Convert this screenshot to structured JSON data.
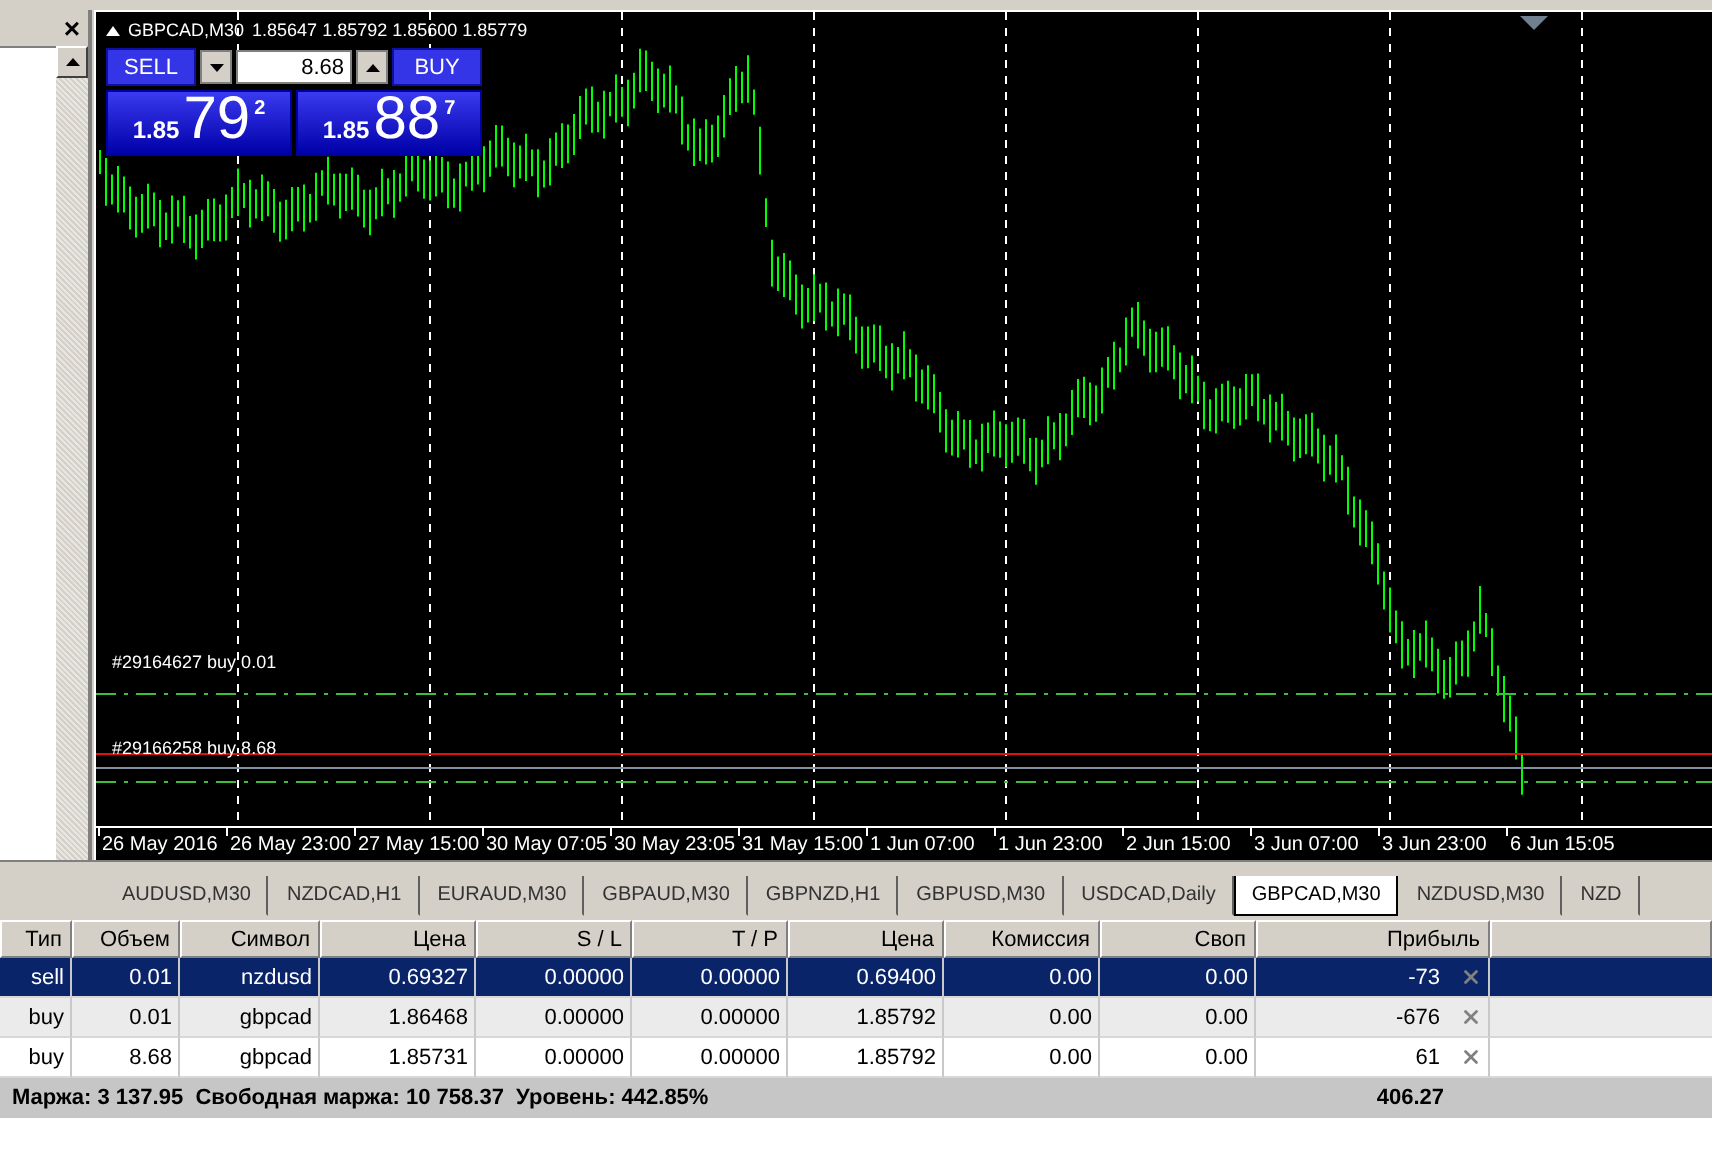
{
  "sidebar": {
    "close": "×"
  },
  "chart": {
    "symbol": "GBPCAD,M30",
    "quotes": "1.85647 1.85792 1.85600 1.85779",
    "trade_panel": {
      "sell_label": "SELL",
      "buy_label": "BUY",
      "volume": "8.68",
      "sell_price": {
        "prefix": "1.85",
        "pips": "79",
        "fraction": "2"
      },
      "buy_price": {
        "prefix": "1.85",
        "pips": "88",
        "fraction": "7"
      }
    },
    "order_lines": [
      {
        "label": "#29164627 buy 0.01"
      },
      {
        "label": "#29166258 buy 8.68"
      }
    ],
    "time_axis": [
      "26 May 2016",
      "26 May 23:00",
      "27 May 15:00",
      "30 May 07:05",
      "30 May 23:05",
      "31 May 15:00",
      "1 Jun 07:00",
      "1 Jun 23:00",
      "2 Jun 15:00",
      "3 Jun 07:00",
      "3 Jun 23:00",
      "6 Jun 15:05"
    ]
  },
  "tabs": [
    {
      "label": "AUDUSD,M30",
      "selected": false
    },
    {
      "label": "NZDCAD,H1",
      "selected": false
    },
    {
      "label": "EURAUD,M30",
      "selected": false
    },
    {
      "label": "GBPAUD,M30",
      "selected": false
    },
    {
      "label": "GBPNZD,H1",
      "selected": false
    },
    {
      "label": "GBPUSD,M30",
      "selected": false
    },
    {
      "label": "USDCAD,Daily",
      "selected": false
    },
    {
      "label": "GBPCAD,M30",
      "selected": true
    },
    {
      "label": "NZDUSD,M30",
      "selected": false
    },
    {
      "label": "NZD",
      "selected": false
    }
  ],
  "trades": {
    "columns": [
      "Тип",
      "Объем",
      "Символ",
      "Цена",
      "S / L",
      "T / P",
      "Цена",
      "Комиссия",
      "Своп",
      "Прибыль"
    ],
    "rows": [
      {
        "cells": [
          "sell",
          "0.01",
          "nzdusd",
          "0.69327",
          "0.00000",
          "0.00000",
          "0.69400",
          "0.00",
          "0.00"
        ],
        "profit": "-73",
        "selected": true
      },
      {
        "cells": [
          "buy",
          "0.01",
          "gbpcad",
          "1.86468",
          "0.00000",
          "0.00000",
          "1.85792",
          "0.00",
          "0.00"
        ],
        "profit": "-676",
        "selected": false
      },
      {
        "cells": [
          "buy",
          "8.68",
          "gbpcad",
          "1.85731",
          "0.00000",
          "0.00000",
          "1.85792",
          "0.00",
          "0.00"
        ],
        "profit": "61",
        "selected": false
      }
    ]
  },
  "summary": {
    "text": "Маржа: 3 137.95  Свободная маржа: 10 758.37  Уровень: 442.85%",
    "total": "406.27"
  }
}
